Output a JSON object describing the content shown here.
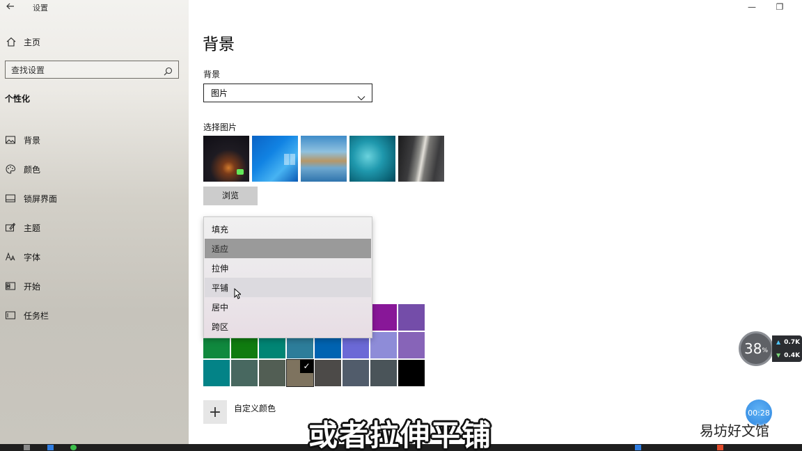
{
  "app": {
    "title": "设置"
  },
  "window_controls": {
    "minimize": "—",
    "restore": "❐"
  },
  "sidebar": {
    "home_label": "主页",
    "search_placeholder": "查找设置",
    "section_title": "个性化",
    "items": [
      {
        "label": "背景",
        "icon": "image-icon"
      },
      {
        "label": "颜色",
        "icon": "palette-icon"
      },
      {
        "label": "锁屏界面",
        "icon": "lock-screen-icon"
      },
      {
        "label": "主题",
        "icon": "theme-icon"
      },
      {
        "label": "字体",
        "icon": "font-icon"
      },
      {
        "label": "开始",
        "icon": "start-icon"
      },
      {
        "label": "任务栏",
        "icon": "taskbar-icon"
      }
    ]
  },
  "main": {
    "page_title": "背景",
    "background_label": "背景",
    "background_value": "图片",
    "choose_picture_label": "选择图片",
    "browse_label": "浏览",
    "custom_color_label": "自定义颜色",
    "custom_color_icon": "+"
  },
  "fit_dropdown": {
    "options": [
      "填充",
      "适应",
      "拉伸",
      "平铺",
      "居中",
      "跨区"
    ],
    "selected": "适应",
    "hovered": "平铺"
  },
  "color_swatches": {
    "rows": [
      [
        "",
        "",
        "",
        "",
        "",
        "",
        "#881798",
        "#744da9"
      ],
      [
        "#10893e",
        "#107c10",
        "#018574",
        "#2d7d9a",
        "#0063b1",
        "#6b69d6",
        "#8e8cd8",
        "#8764b8"
      ],
      [
        "#038387",
        "#486860",
        "#525e54",
        "#7e735f",
        "#4c4a48",
        "#515c6b",
        "#4a5459",
        "#000000"
      ]
    ],
    "selected_color": "#7e735f",
    "check_glyph": "✓"
  },
  "overlay": {
    "speed_percent": "38",
    "speed_unit": "%",
    "upload": "0.7K",
    "download": "0.4K",
    "timer": "00:28",
    "subtitle": "或者拉伸平铺",
    "watermark": "易坊好文馆"
  }
}
